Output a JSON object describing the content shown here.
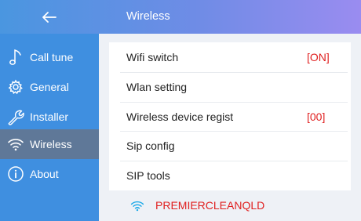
{
  "header": {
    "title": "Wireless"
  },
  "sidebar": {
    "items": [
      {
        "label": "Call tune",
        "icon": "music-note-icon"
      },
      {
        "label": "General",
        "icon": "gear-icon"
      },
      {
        "label": "Installer",
        "icon": "wrench-icon"
      },
      {
        "label": "Wireless",
        "icon": "wifi-icon",
        "active": true
      },
      {
        "label": "About",
        "icon": "info-icon"
      }
    ]
  },
  "settings": {
    "rows": [
      {
        "label": "Wifi switch",
        "value": "[ON]"
      },
      {
        "label": "Wlan setting",
        "value": ""
      },
      {
        "label": "Wireless device regist",
        "value": "[00]"
      },
      {
        "label": "Sip config",
        "value": ""
      },
      {
        "label": "SIP tools",
        "value": ""
      }
    ]
  },
  "network": {
    "ssid": "PREMIERCLEANQLD",
    "icon": "wifi-icon"
  },
  "colors": {
    "sidebar_bg": "#3f8fe0",
    "active_item_bg": "#5f7898",
    "value_red": "#e02020",
    "wifi_icon": "#1aa8e8"
  }
}
